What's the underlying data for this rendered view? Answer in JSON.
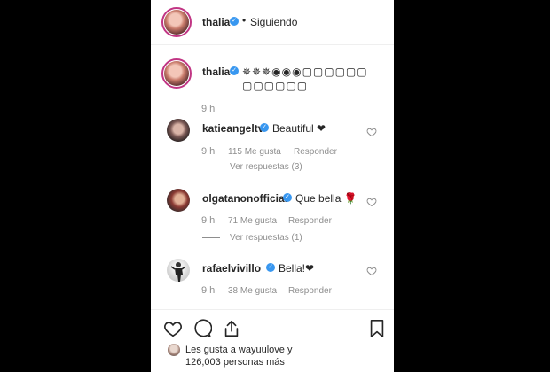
{
  "post": {
    "author": "thalia",
    "follow_status": "Siguiendo",
    "caption": "✵✵✵◉◉◉▢▢▢▢▢▢▢▢▢▢▢▢",
    "caption_time": "9 h"
  },
  "comments": [
    {
      "user": "katieangeltv",
      "text": "Beautiful ❤",
      "time": "9 h",
      "likes": "115 Me gusta",
      "reply": "Responder",
      "view_replies": "Ver respuestas (3)"
    },
    {
      "user": "olgatanonofficial",
      "text": "Que bella 🌹",
      "time": "9 h",
      "likes": "71 Me gusta",
      "reply": "Responder",
      "view_replies": "Ver respuestas (1)"
    },
    {
      "user": "rafaelvivillo",
      "text": "Bella!❤",
      "time": "9 h",
      "likes": "38 Me gusta",
      "reply": "Responder"
    }
  ],
  "liked_by": {
    "line1": "Les gusta a wayuulove y",
    "line2": "126,003 personas más"
  },
  "icons": [
    "heart-icon",
    "comment-icon",
    "share-icon",
    "bookmark-icon",
    "verified-icon"
  ],
  "colors": {
    "verified": "#3897f0",
    "muted": "#8e8e8e",
    "text": "#262626"
  }
}
